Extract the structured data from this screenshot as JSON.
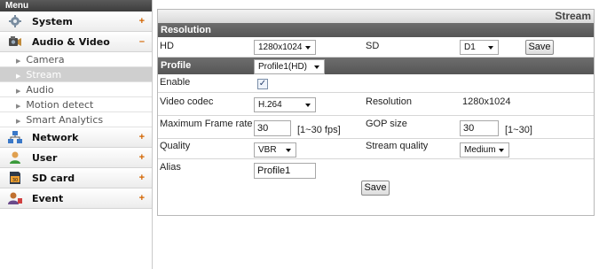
{
  "sidebar": {
    "header": "Menu",
    "items": [
      {
        "label": "System",
        "toggle": "+",
        "icon": "gear-icon"
      },
      {
        "label": "Audio & Video",
        "toggle": "–",
        "icon": "camera-icon",
        "children": [
          "Camera",
          "Stream",
          "Audio",
          "Motion detect",
          "Smart Analytics"
        ],
        "active_child": "Stream"
      },
      {
        "label": "Network",
        "toggle": "+",
        "icon": "network-icon"
      },
      {
        "label": "User",
        "toggle": "+",
        "icon": "user-icon"
      },
      {
        "label": "SD card",
        "toggle": "+",
        "icon": "sd-card-icon"
      },
      {
        "label": "Event",
        "toggle": "+",
        "icon": "event-icon"
      }
    ]
  },
  "main": {
    "page_title": "Stream",
    "resolution": {
      "section_title": "Resolution",
      "hd_label": "HD",
      "hd_value": "1280x1024",
      "sd_label": "SD",
      "sd_value": "D1",
      "save_label": "Save"
    },
    "profile": {
      "section_title": "Profile",
      "profile_value": "Profile1(HD)",
      "enable_label": "Enable",
      "enable_checked": true,
      "video_codec_label": "Video codec",
      "video_codec_value": "H.264",
      "resolution_label": "Resolution",
      "resolution_value": "1280x1024",
      "max_frame_rate_label": "Maximum Frame rate",
      "max_frame_rate_value": "30",
      "max_frame_rate_hint": "[1~30 fps]",
      "gop_size_label": "GOP size",
      "gop_size_value": "30",
      "gop_size_hint": "[1~30]",
      "quality_label": "Quality",
      "quality_value": "VBR",
      "stream_quality_label": "Stream quality",
      "stream_quality_value": "Medium",
      "alias_label": "Alias",
      "alias_value": "Profile1",
      "save_label": "Save"
    }
  }
}
